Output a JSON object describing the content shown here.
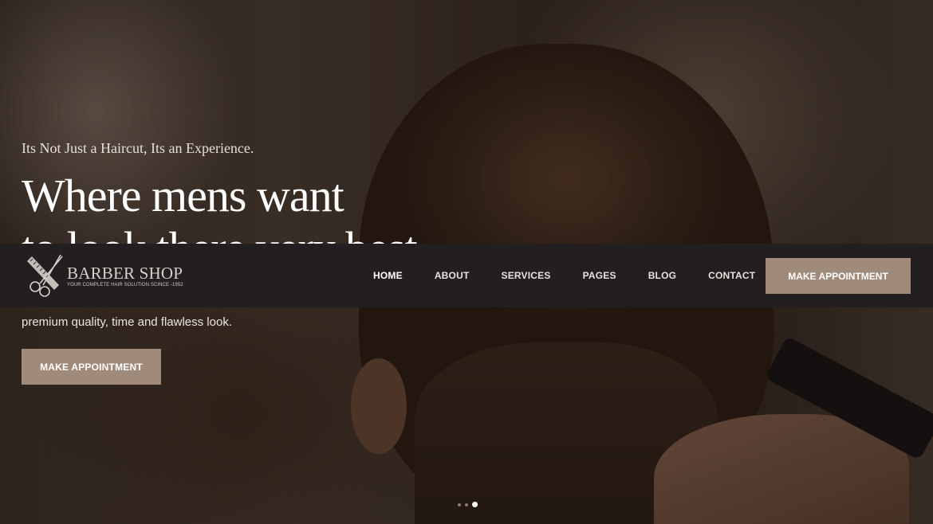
{
  "hero": {
    "tagline": "Its Not Just a Haircut, Its an Experience.",
    "headline_line1": "Where mens want",
    "headline_line2": "to look there very best",
    "description_line1": "",
    "description_line2": "premium quality, time and flawless look.",
    "button_label": "MAKE APPOINTMENT"
  },
  "navbar": {
    "logo_name": "BARBER SHOP",
    "logo_subtitle": "YOUR COMPLETE HAIR SOLUTION SCINCE -1952",
    "items": [
      {
        "label": "HOME",
        "active": true
      },
      {
        "label": "ABOUT",
        "active": false
      },
      {
        "label": "SERVICES",
        "active": false
      },
      {
        "label": "PAGES",
        "active": false
      },
      {
        "label": "BLOG",
        "active": false
      },
      {
        "label": "CONTACT",
        "active": false
      }
    ],
    "cta_label": "MAKE APPOINTMENT"
  },
  "slider": {
    "total": 3,
    "active_index": 2
  },
  "colors": {
    "accent": "#a08b7b",
    "navbar_bg": "#231f20"
  },
  "icons": {
    "logo": "scissors-comb-icon"
  }
}
